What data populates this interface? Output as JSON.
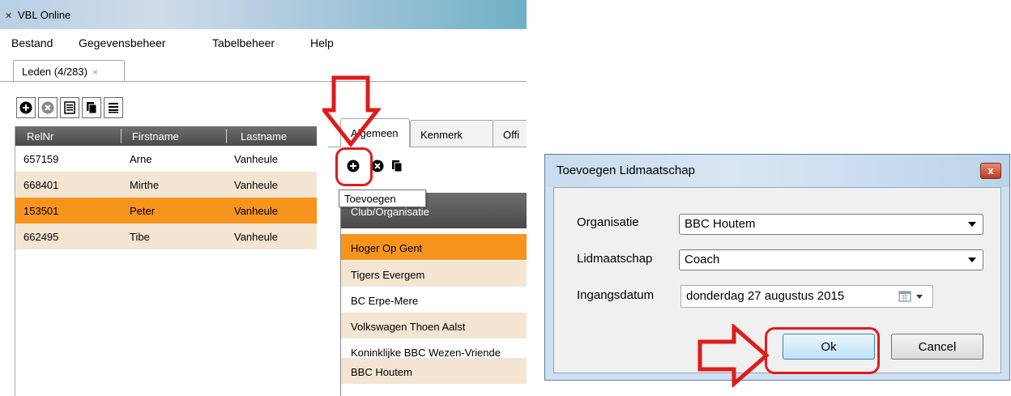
{
  "app": {
    "title": "VBL Online",
    "menu": [
      "Bestand",
      "Gegevensbeheer",
      "Tabelbeheer",
      "Help"
    ],
    "tab": {
      "label": "Leden (4/283)",
      "close": "×"
    },
    "toolbar_icons": [
      "add-icon",
      "delete-icon",
      "list-icon",
      "copy-icon",
      "lines-icon"
    ],
    "grid": {
      "columns": [
        "RelNr",
        "Firstname",
        "Lastname"
      ],
      "rows": [
        {
          "relnr": "657159",
          "firstname": "Arne",
          "lastname": "Vanheule"
        },
        {
          "relnr": "668401",
          "firstname": "Mirthe",
          "lastname": "Vanheule"
        },
        {
          "relnr": "153501",
          "firstname": "Peter",
          "lastname": "Vanheule"
        },
        {
          "relnr": "662495",
          "firstname": "Tibe",
          "lastname": "Vanheule"
        }
      ],
      "selected_index": 2
    },
    "detail": {
      "tabs": [
        "Algemeen",
        "Kenmerk",
        "Offi"
      ],
      "toolbar_icons": [
        "add-icon",
        "delete-icon",
        "copy-icon"
      ],
      "tooltip": "Toevoegen",
      "club_column": "Club/Organisatie",
      "clubs": [
        "Hoger Op Gent",
        "Tigers Evergem",
        "BC Erpe-Mere",
        "Volkswagen Thoen Aalst",
        "Koninklijke BBC Wezen-Vriende",
        "BBC Houtem"
      ],
      "selected_club_index": 0
    }
  },
  "dialog": {
    "title": "Toevoegen Lidmaatschap",
    "close": "x",
    "fields": {
      "organisatie_label": "Organisatie",
      "organisatie_value": "BBC Houtem",
      "lidmaatschap_label": "Lidmaatschap",
      "lidmaatschap_value": "Coach",
      "ingangsdatum_label": "Ingangsdatum",
      "ingangsdatum_value": "donderdag 27 augustus 2015"
    },
    "ok_label": "Ok",
    "cancel_label": "Cancel"
  },
  "colors": {
    "selected_row": "#f7941d",
    "alt_row": "#f4e5d2",
    "header_dark": "#555555",
    "annotation_red": "#e01b1b"
  }
}
